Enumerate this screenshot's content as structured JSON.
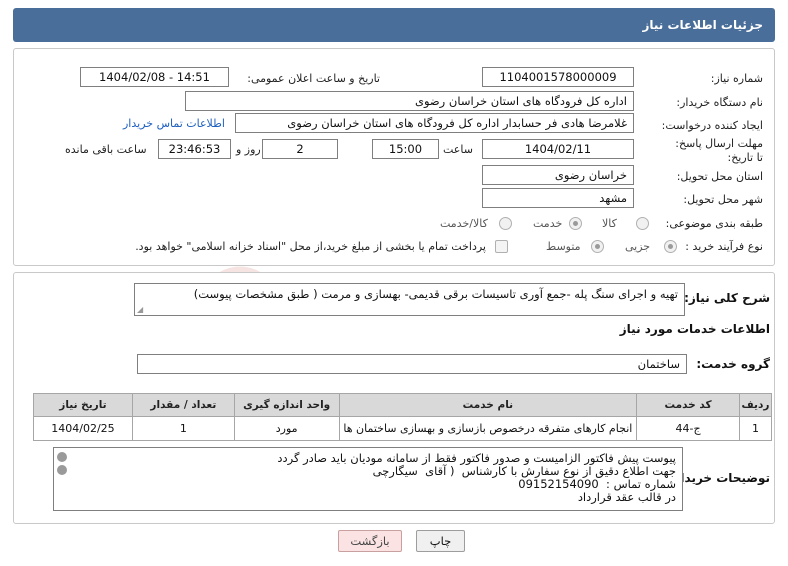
{
  "header": {
    "title": "جزئیات اطلاعات نیاز"
  },
  "form": {
    "need_number_label": "شماره نیاز:",
    "need_number": "1104001578000009",
    "announce_label": "تاریخ و ساعت اعلان عمومی:",
    "announce_value": "1404/02/08 - 14:51",
    "buyer_label": "نام دستگاه خریدار:",
    "buyer_value": "اداره کل فرودگاه های استان خراسان رضوی",
    "creator_label": "ایجاد کننده درخواست:",
    "creator_value": "غلامرضا هادی فر حسابدار اداره کل فرودگاه های استان خراسان رضوی",
    "contact_link": "اطلاعات تماس خریدار",
    "deadline_label": "مهلت ارسال پاسخ: تا تاریخ:",
    "deadline_date": "1404/02/11",
    "time_label": "ساعت",
    "deadline_time": "15:00",
    "days_value": "2",
    "days_label": "روز و",
    "remaining_value": "23:46:53",
    "remaining_label": "ساعت باقی مانده",
    "province_label": "استان محل تحویل:",
    "province_value": "خراسان رضوی",
    "city_label": "شهر محل تحویل:",
    "city_value": "مشهد",
    "category_label": "طبقه بندی موضوعی:",
    "category_options": [
      "کالا",
      "خدمت",
      "کالا/خدمت"
    ],
    "category_selected": "خدمت",
    "process_label": "نوع فرآیند خرید :",
    "process_options": [
      "جزیی",
      "متوسط"
    ],
    "process_selected": "جزیی",
    "payment_note": "پرداخت تمام یا بخشی از مبلغ خرید،از محل \"اسناد خزانه اسلامی\" خواهد بود."
  },
  "summary": {
    "label": "شرح کلی نیاز:",
    "value": "تهیه و اجرای سنگ پله -جمع آوری تاسیسات برقی قدیمی- بهسازی و مرمت ( طبق مشخصات پیوست)"
  },
  "services": {
    "section_title": "اطلاعات خدمات مورد نیاز",
    "group_label": "گروه خدمت:",
    "group_value": "ساختمان",
    "columns": [
      "ردیف",
      "کد خدمت",
      "نام خدمت",
      "واحد اندازه گیری",
      "تعداد / مقدار",
      "تاریخ نیاز"
    ],
    "rows": [
      {
        "row": "1",
        "code": "ج-44",
        "name": "انجام کارهای متفرقه درخصوص بازسازی و بهسازی ساختمان ها",
        "unit": "مورد",
        "qty": "1",
        "date": "1404/02/25"
      }
    ]
  },
  "buyer_notes": {
    "label": "توضیحات خریدار:",
    "text": "پیوست پیش فاکتور الزامیست و صدور فاکتور فقط از سامانه مودیان باید صادر گردد\nجهت اطلاع دقیق از نوع سفارش با کارشناس  ( آقای  سیگارچی\nشماره تماس :  09152154090\nدر قالب عقد قرارداد"
  },
  "buttons": {
    "print": "چاپ",
    "back": "بازگشت"
  },
  "watermark": {
    "text": "AriaTender.neT"
  },
  "colors": {
    "header": "#4a6e9a",
    "link": "#1e5fbf",
    "back_button": "#fbe3e3"
  }
}
